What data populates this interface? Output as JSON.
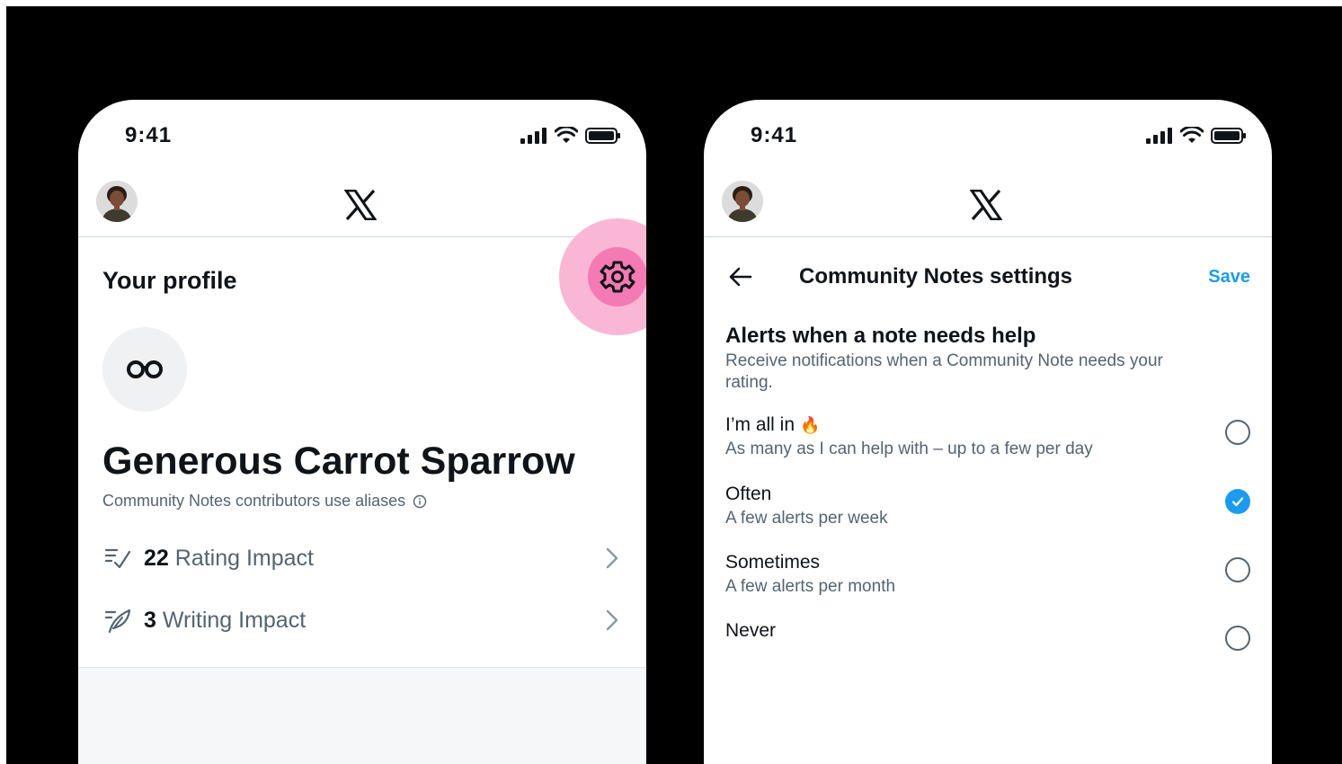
{
  "left_phone": {
    "status": {
      "time": "9:41"
    },
    "header": {
      "logo_icon": "x-logo-icon"
    },
    "title": "Your profile",
    "settings_icon": "gear-icon",
    "alias_icon": "glasses-icon",
    "alias_name": "Generous Carrot Sparrow",
    "alias_note": "Community Notes contributors use aliases",
    "impacts": [
      {
        "count": "22",
        "label": "Rating Impact",
        "icon": "rating-list-check-icon"
      },
      {
        "count": "3",
        "label": "Writing Impact",
        "icon": "writing-feather-icon"
      }
    ]
  },
  "right_phone": {
    "status": {
      "time": "9:41"
    },
    "header": {
      "logo_icon": "x-logo-icon"
    },
    "title": "Community Notes settings",
    "save_label": "Save",
    "section": {
      "title": "Alerts when a note needs help",
      "description": "Receive notifications when a Community Note needs your rating."
    },
    "options": [
      {
        "label": "I’m all in",
        "emoji": "🔥",
        "sublabel": "As many as I can help with – up to a few per day",
        "selected": false
      },
      {
        "label": "Often",
        "sublabel": "A few alerts per week",
        "selected": true
      },
      {
        "label": "Sometimes",
        "sublabel": "A few alerts per month",
        "selected": false
      },
      {
        "label": "Never",
        "sublabel": "",
        "selected": false
      }
    ]
  },
  "colors": {
    "accent_blue": "#1d9bf0",
    "highlight_pink": "#f47ab4",
    "text_primary": "#0f1419",
    "text_secondary": "#536471"
  }
}
